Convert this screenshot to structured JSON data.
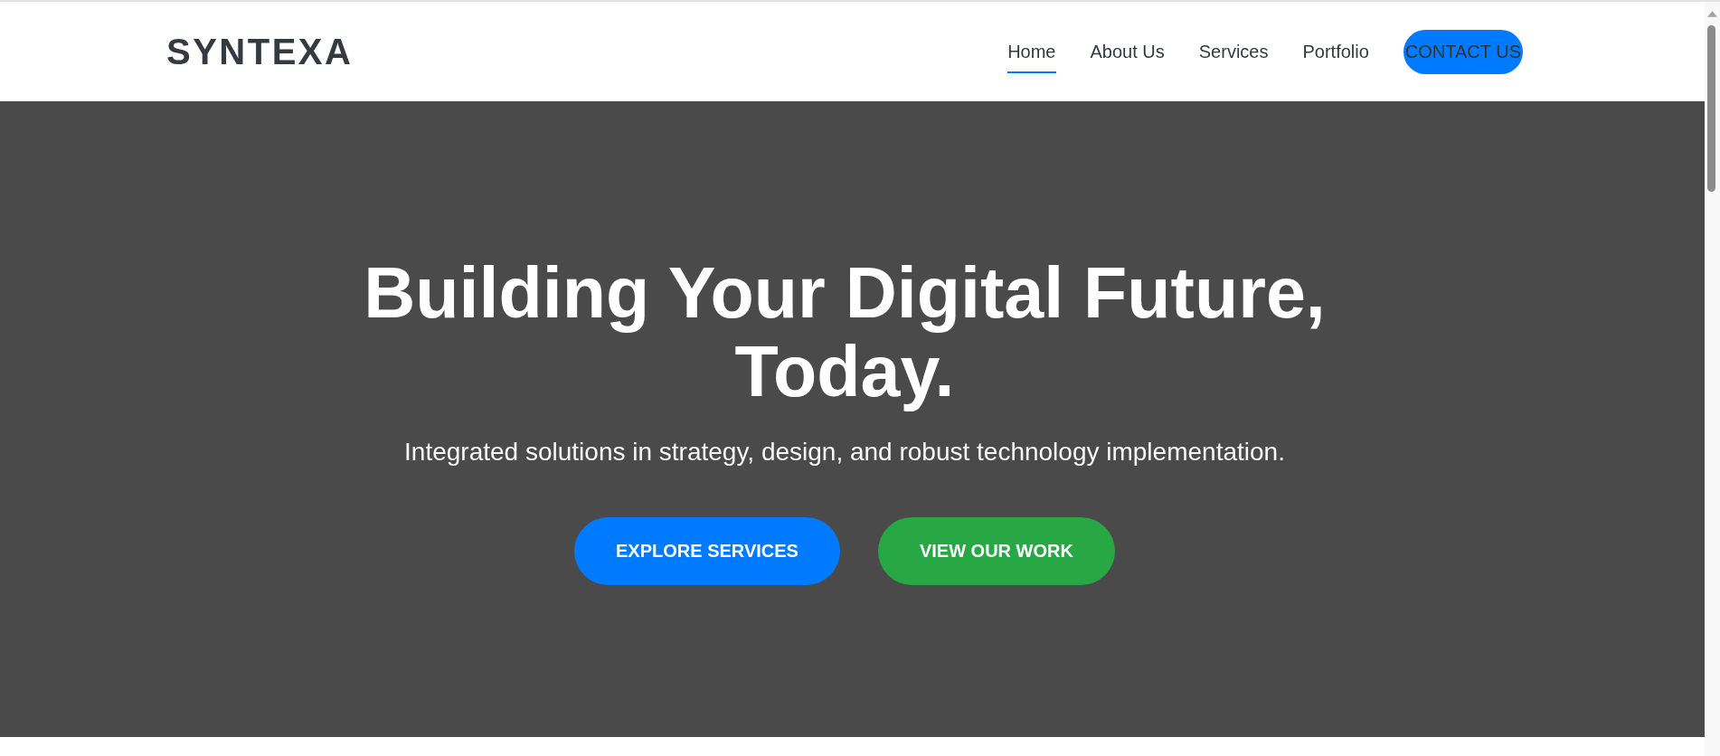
{
  "header": {
    "logo": "SYNTEXA",
    "nav": [
      {
        "label": "Home",
        "selected": true
      },
      {
        "label": "About Us",
        "selected": false
      },
      {
        "label": "Services",
        "selected": false
      },
      {
        "label": "Portfolio",
        "selected": false
      }
    ],
    "cta": "CONTACT US"
  },
  "hero": {
    "title": "Building Your Digital Future, Today.",
    "subtitle": "Integrated solutions in strategy, design, and robust technology implementation.",
    "buttons": [
      {
        "label": "EXPLORE SERVICES",
        "kind": "primary"
      },
      {
        "label": "VIEW OUR WORK",
        "kind": "success"
      }
    ]
  }
}
